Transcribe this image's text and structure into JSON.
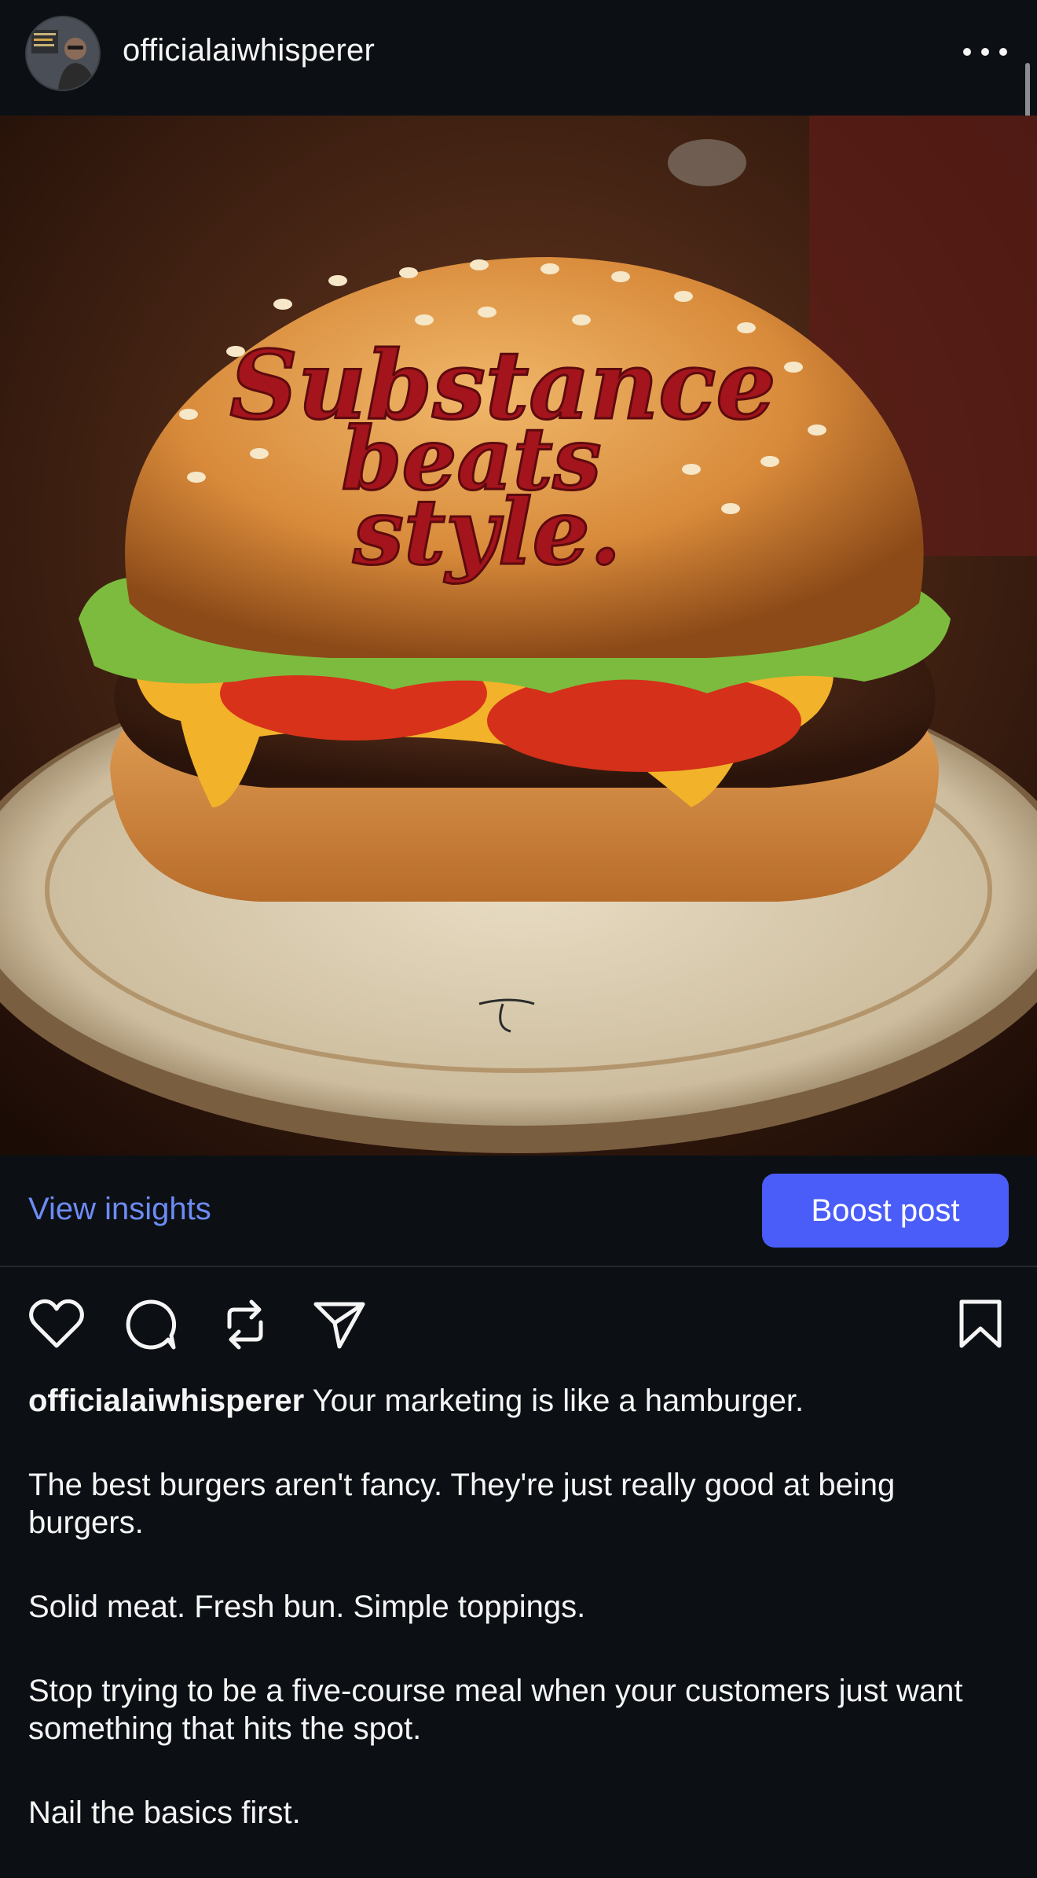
{
  "header": {
    "username": "officialaiwhisperer",
    "avatar_icon": "profile-avatar",
    "more_icon": "more-horizontal-icon"
  },
  "image": {
    "bun_text_line1": "Substance",
    "bun_text_line2": "beats",
    "bun_text_line3": "style."
  },
  "insights": {
    "view_insights_label": "View insights",
    "boost_label": "Boost post"
  },
  "actions": {
    "like_icon": "heart-icon",
    "comment_icon": "comment-icon",
    "repost_icon": "repost-icon",
    "share_icon": "send-icon",
    "save_icon": "bookmark-icon"
  },
  "caption": {
    "author": "officialaiwhisperer",
    "first_line": "Your marketing is like a hamburger.",
    "paragraphs": [
      "The best burgers aren't fancy. They're just really good at being burgers.",
      "Solid meat. Fresh bun. Simple toppings.",
      "Stop trying to be a five-course meal when your customers just want something that hits the spot.",
      "Nail the basics first."
    ]
  },
  "colors": {
    "background": "#0c1014",
    "link_blue": "#6d8bf5",
    "boost_blue": "#4a5df9"
  }
}
